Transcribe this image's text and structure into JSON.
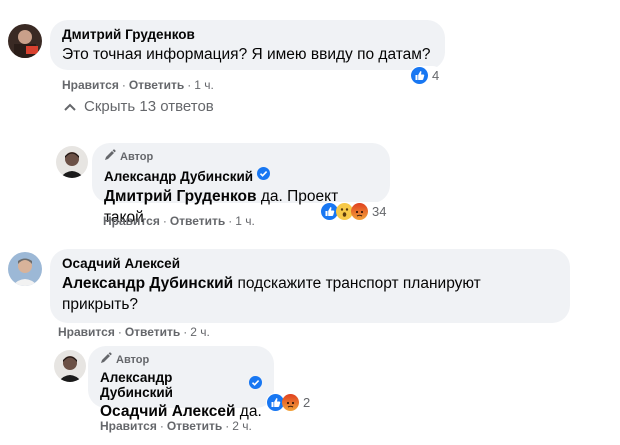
{
  "comments": [
    {
      "author": "Дмитрий Груденков",
      "text": "Это точная информация? Я имею ввиду по датам?",
      "like_label": "Нравится",
      "reply_label": "Ответить",
      "time": "1 ч.",
      "reaction_count": "4"
    },
    {
      "collapse_label": "Скрыть 13 ответов"
    },
    {
      "badge": "Автор",
      "author": "Александр Дубинский",
      "mention": "Дмитрий Груденков",
      "text": " да. Проект такой",
      "like_label": "Нравится",
      "reply_label": "Ответить",
      "time": "1 ч.",
      "reaction_count": "34"
    },
    {
      "author": "Осадчий Алексей",
      "mention": "Александр Дубинский",
      "text_line1": " подскажите транспорт планируют",
      "text_line2": "прикрыть?",
      "like_label": "Нравится",
      "reply_label": "Ответить",
      "time": "2 ч."
    },
    {
      "badge": "Автор",
      "author": "Александр Дубинский",
      "mention": "Осадчий Алексей",
      "text": " да.",
      "like_label": "Нравится",
      "reply_label": "Ответить",
      "time": "2 ч.",
      "reaction_count": "2"
    }
  ],
  "colors": {
    "bubble": "#f0f2f5",
    "meta_text": "#65676b",
    "like_blue": "#1877f2",
    "angry_red": "#e9710f"
  },
  "icons": [
    "pencil-icon",
    "verified-badge-icon",
    "like-reaction-icon",
    "wow-reaction-icon",
    "angry-reaction-icon",
    "chevron-up-icon"
  ]
}
